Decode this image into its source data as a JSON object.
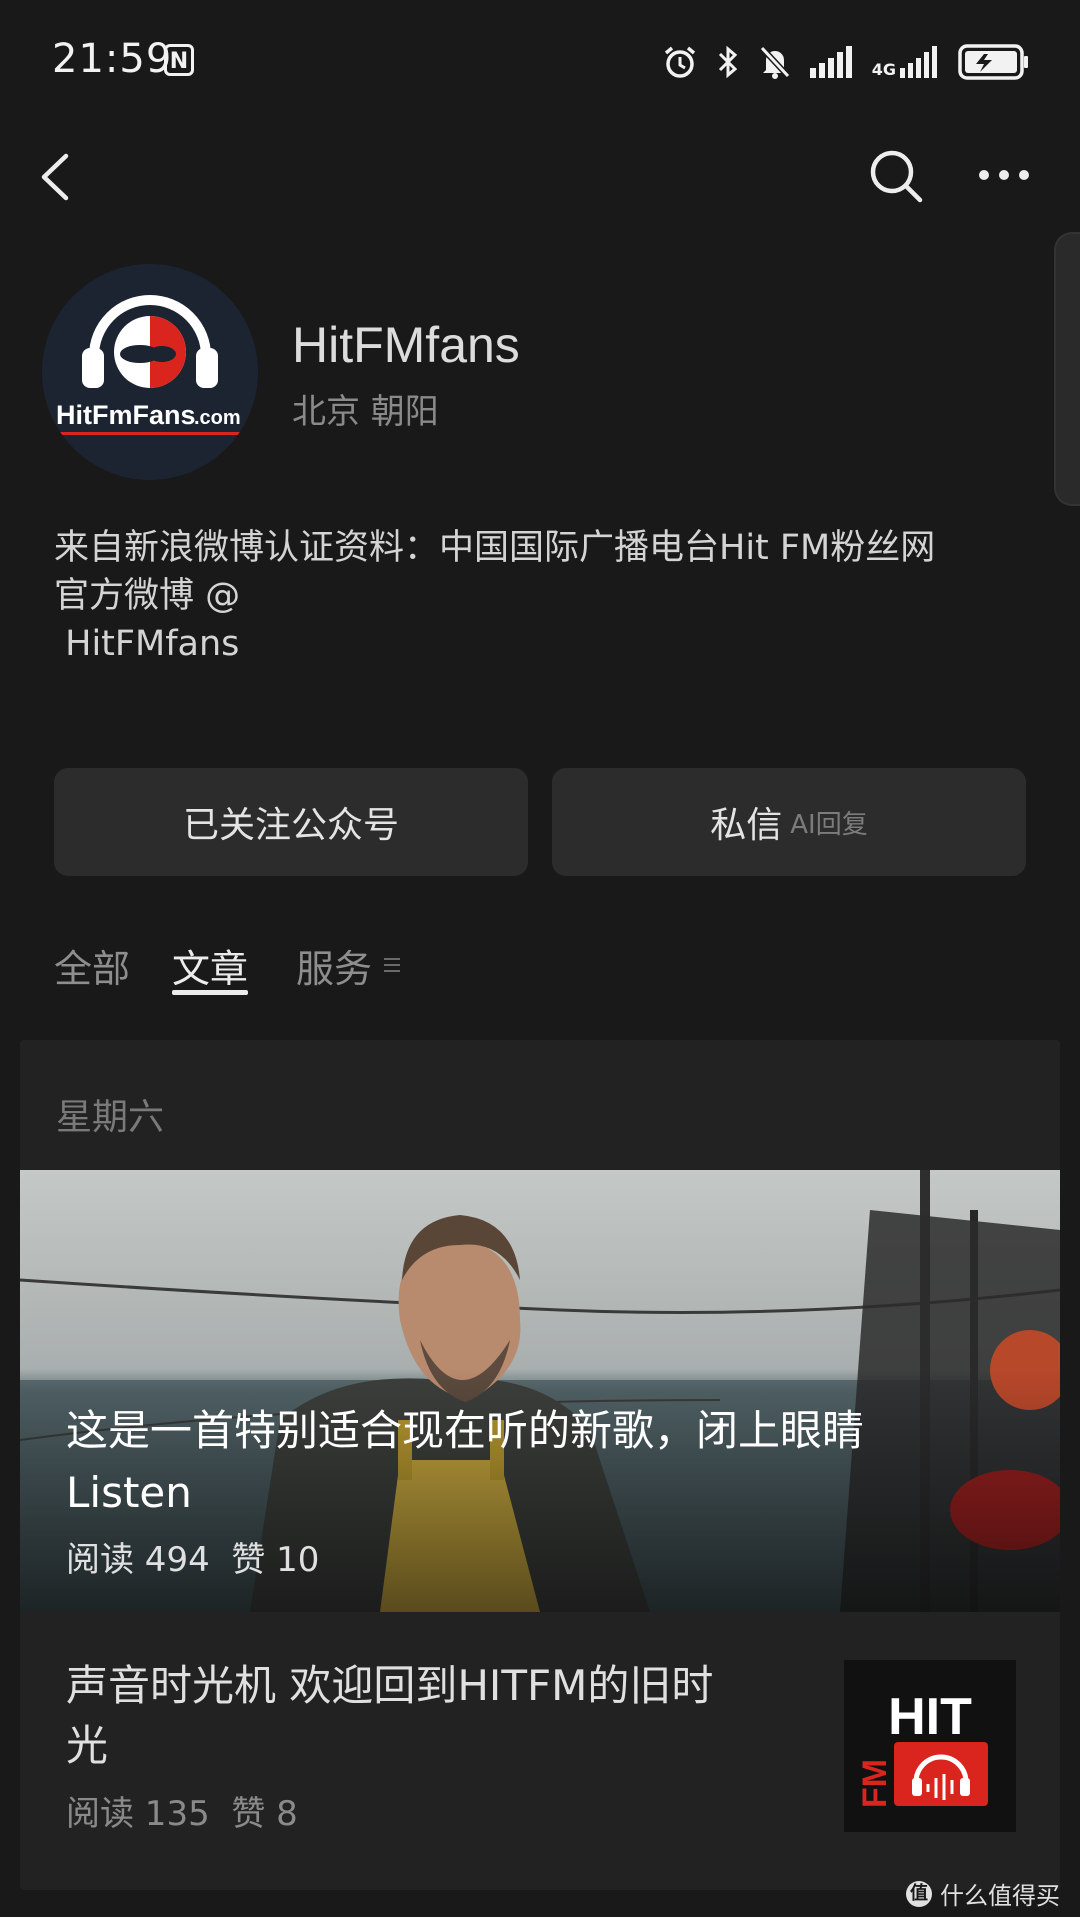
{
  "status_bar": {
    "time": "21:59",
    "nfc_glyph": "N",
    "network": "4G",
    "icons": [
      "alarm-icon",
      "bluetooth-icon",
      "mute-bell-icon",
      "signal-icon",
      "signal-4g-icon",
      "battery-charging-icon"
    ]
  },
  "nav": {
    "back_icon": "chevron-left-icon",
    "search_icon": "search-icon",
    "more_icon": "more-dots-icon"
  },
  "profile": {
    "name": "HitFMfans",
    "location": "北京 朝阳",
    "description_lines": [
      "来自新浪微博认证资料：中国国际广播电台Hit FM粉丝网",
      "官方微博 @",
      " HitFMfans"
    ],
    "avatar_logo_text": "HitFmFans",
    "avatar_logo_suffix": ".com"
  },
  "actions": {
    "follow_label": "已关注公众号",
    "message_label": "私信",
    "message_sub_label": "AI回复"
  },
  "tabs": [
    {
      "label": "全部",
      "active": false
    },
    {
      "label": "文章",
      "active": true
    },
    {
      "label": "服务",
      "active": false
    }
  ],
  "feed": {
    "day_label": "星期六",
    "featured": {
      "title_lines": [
        "这是一首特别适合现在听的新歌，闭上眼睛",
        "Listen"
      ],
      "stats": "阅读 494  赞 10"
    },
    "items": [
      {
        "title_lines": [
          "声音时光机 欢迎回到HITFM的旧时",
          "光"
        ],
        "stats": "阅读 135  赞 8",
        "thumb_text_top": "HIT",
        "thumb_text_side": "FM"
      }
    ]
  },
  "watermark": {
    "badge": "值",
    "text": "什么值得买"
  },
  "colors": {
    "background": "#191919",
    "card": "#222222",
    "button": "#2c2c2c",
    "logo_red": "#d9251d"
  }
}
